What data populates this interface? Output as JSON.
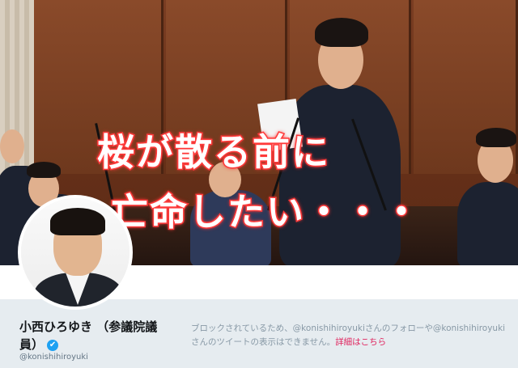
{
  "header": {
    "overlay_line1": "桜が散る前に",
    "overlay_line2": "亡命したい・・・"
  },
  "profile": {
    "name_line1": "小西ひろゆき （参議院議",
    "name_line2": "員）",
    "verified_icon": "✔",
    "handle": "@konishihiroyuki"
  },
  "blocked_notice": {
    "text": "ブロックされているため、@konishihiroyukiさんのフォローや@konishihiroyukiさんのツイートの表示はできません。",
    "link_text": "詳細はこちら"
  },
  "colors": {
    "overlay_stroke": "#ff3b3b",
    "link": "#e0245e",
    "verified": "#1da1f2",
    "background": "#e6ecf0"
  }
}
